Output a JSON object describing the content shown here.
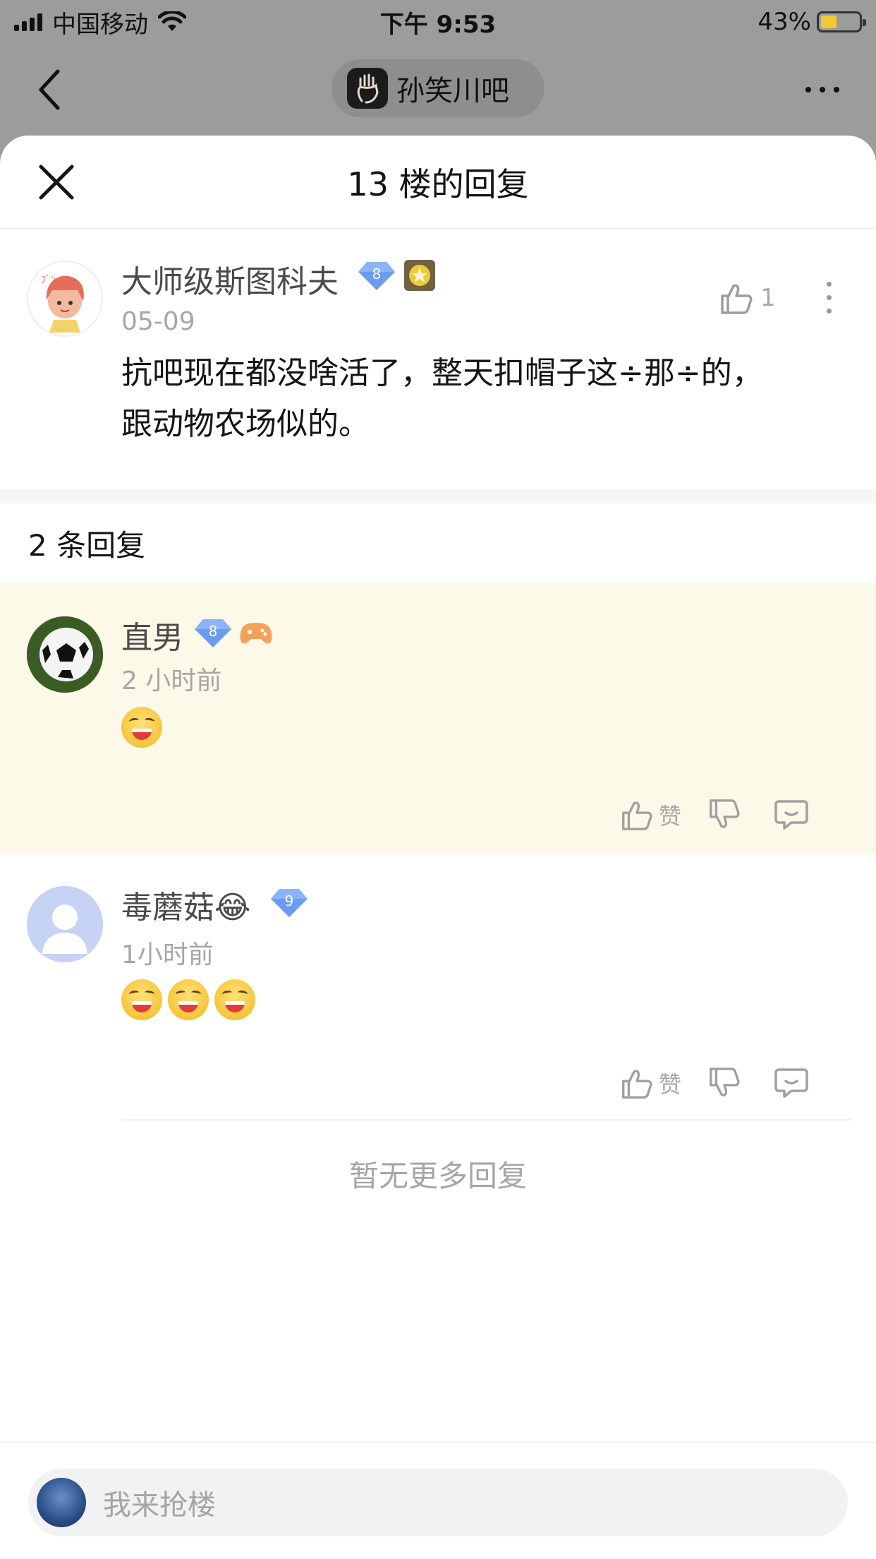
{
  "status_bar": {
    "carrier": "中国移动",
    "time": "下午 9:53",
    "battery_percent": "43%",
    "battery_level": 0.43
  },
  "nav": {
    "forum_name": "孙笑川吧"
  },
  "sheet": {
    "title": "13 楼的回复"
  },
  "main_post": {
    "username": "大师级斯图科夫",
    "level": "8",
    "date": "05-09",
    "like_count": "1",
    "content_line1": "抗吧现在都没啥活了，整天扣帽子这÷那÷的，",
    "content_line2": "跟动物农场似的。"
  },
  "replies_count_label": "2 条回复",
  "replies": [
    {
      "username": "直男",
      "level": "8",
      "time": "2 小时前",
      "emoji_count": 1,
      "like_label": "赞"
    },
    {
      "username": "毒蘑菇",
      "username_emoji": "😂",
      "level": "9",
      "time": "1小时前",
      "emoji_count": 3,
      "like_label": "赞"
    }
  ],
  "no_more_label": "暂无更多回复",
  "input": {
    "placeholder": "我来抢楼"
  },
  "colors": {
    "highlight_bg": "#fdf9e8",
    "level_badge": "#5b8def",
    "muted_text": "#a6a6a6"
  }
}
